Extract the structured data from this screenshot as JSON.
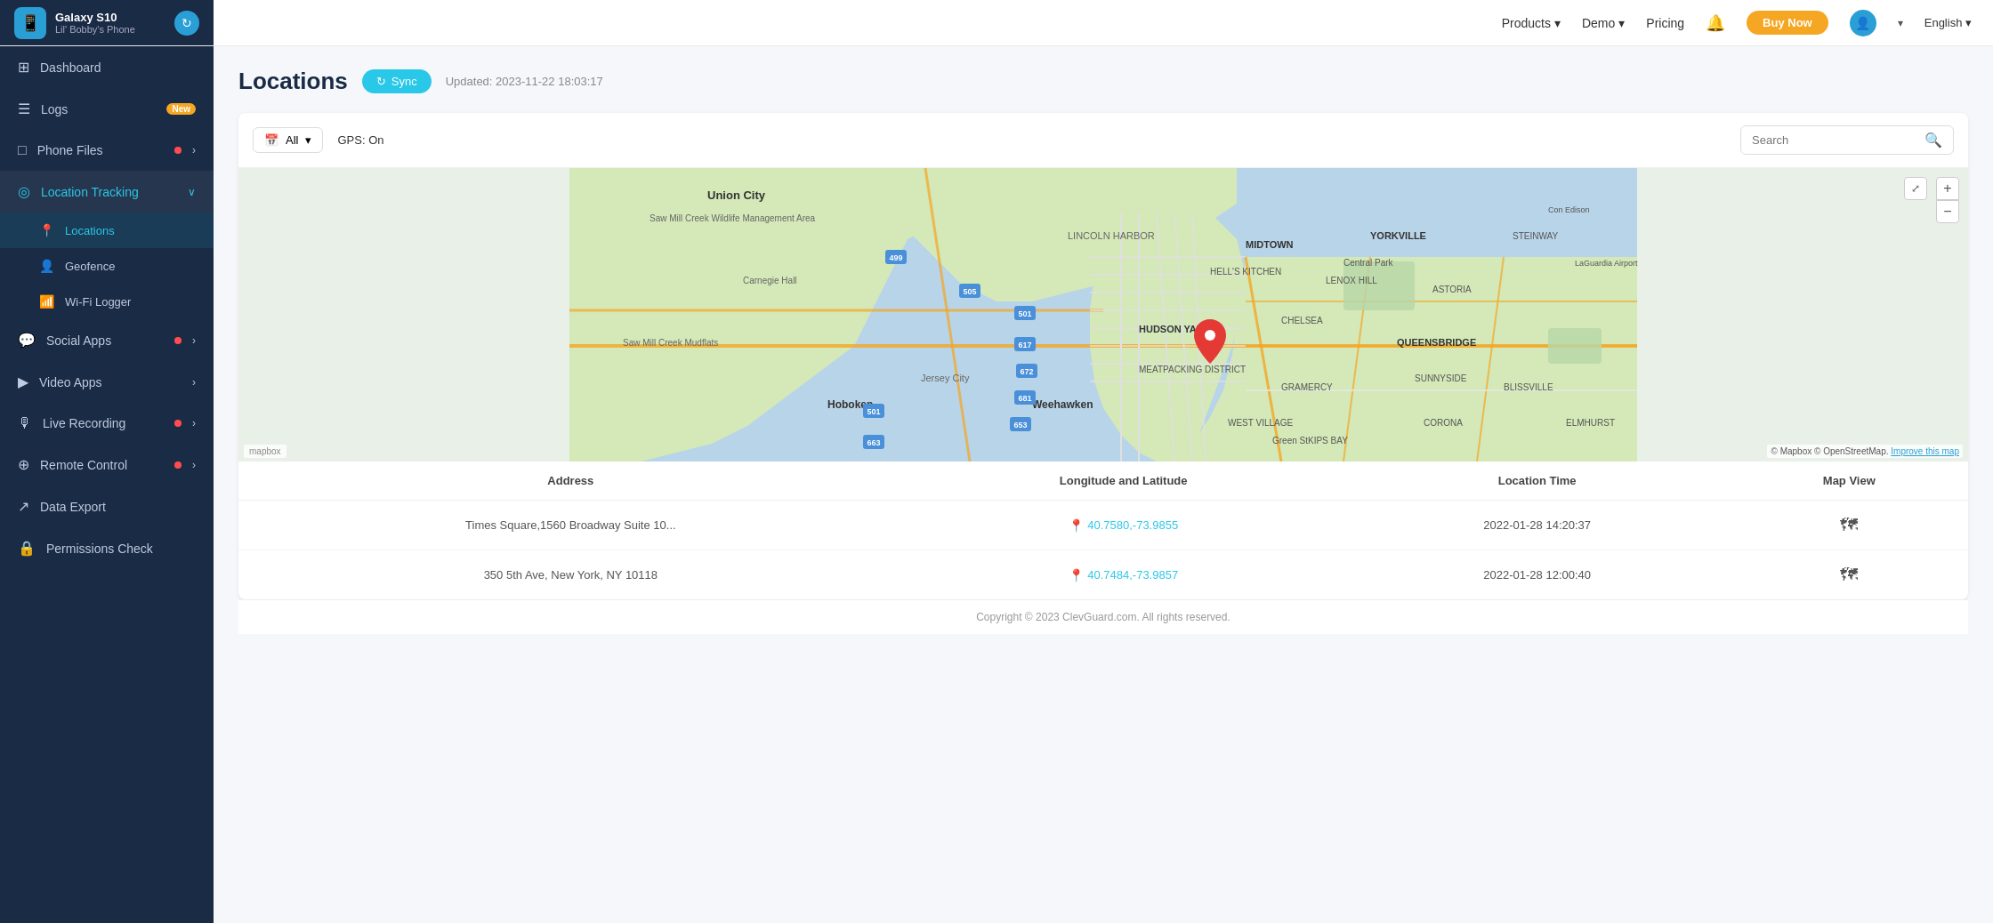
{
  "topnav": {
    "device_name": "Galaxy S10",
    "device_sub": "Lil' Bobby's Phone",
    "nav_items": [
      {
        "label": "Products",
        "has_arrow": true
      },
      {
        "label": "Demo",
        "has_arrow": true
      },
      {
        "label": "Pricing",
        "has_arrow": false
      }
    ],
    "buy_now": "Buy Now",
    "language": "English"
  },
  "sidebar": {
    "items": [
      {
        "id": "dashboard",
        "label": "Dashboard",
        "icon": "⊞",
        "badge": null,
        "dot": false,
        "chevron": false
      },
      {
        "id": "logs",
        "label": "Logs",
        "icon": "☰",
        "badge": "New",
        "dot": false,
        "chevron": false
      },
      {
        "id": "phone-files",
        "label": "Phone Files",
        "icon": "□",
        "badge": null,
        "dot": true,
        "chevron": true
      },
      {
        "id": "location-tracking",
        "label": "Location Tracking",
        "icon": "◎",
        "badge": null,
        "dot": false,
        "chevron": true,
        "expanded": true
      },
      {
        "id": "social-apps",
        "label": "Social Apps",
        "icon": "💬",
        "badge": null,
        "dot": true,
        "chevron": true
      },
      {
        "id": "video-apps",
        "label": "Video Apps",
        "icon": "▶",
        "badge": null,
        "dot": false,
        "chevron": true
      },
      {
        "id": "live-recording",
        "label": "Live Recording",
        "icon": "🎙",
        "badge": null,
        "dot": true,
        "chevron": true
      },
      {
        "id": "remote-control",
        "label": "Remote Control",
        "icon": "⊕",
        "badge": null,
        "dot": true,
        "chevron": true
      },
      {
        "id": "data-export",
        "label": "Data Export",
        "icon": "↗",
        "badge": null,
        "dot": false,
        "chevron": false
      },
      {
        "id": "permissions-check",
        "label": "Permissions Check",
        "icon": "🔒",
        "badge": null,
        "dot": false,
        "chevron": false
      }
    ],
    "sub_items": [
      {
        "id": "locations",
        "label": "Locations",
        "icon": "📍",
        "active": true
      },
      {
        "id": "geofence",
        "label": "Geofence",
        "icon": "👤"
      },
      {
        "id": "wifi-logger",
        "label": "Wi-Fi Logger",
        "icon": "📶"
      }
    ]
  },
  "page": {
    "title": "Locations",
    "sync_label": "Sync",
    "updated_text": "Updated: 2023-11-22 18:03:17"
  },
  "filter": {
    "date_label": "All",
    "gps_status": "GPS: On",
    "search_placeholder": "Search"
  },
  "table": {
    "headers": [
      "Address",
      "Longitude and Latitude",
      "Location Time",
      "Map View"
    ],
    "rows": [
      {
        "address": "Times Square,1560 Broadway Suite 10...",
        "coords": "40.7580,-73.9855",
        "time": "2022-01-28 14:20:37"
      },
      {
        "address": "350 5th Ave, New York, NY 10118",
        "coords": "40.7484,-73.9857",
        "time": "2022-01-28 12:00:40"
      }
    ]
  },
  "footer": {
    "text": "Copyright © 2023 ClevGuard.com. All rights reserved."
  },
  "map": {
    "attribution": "© Mapbox © OpenStreetMap.",
    "improve_link": "Improve this map",
    "logo": "mapbox"
  }
}
